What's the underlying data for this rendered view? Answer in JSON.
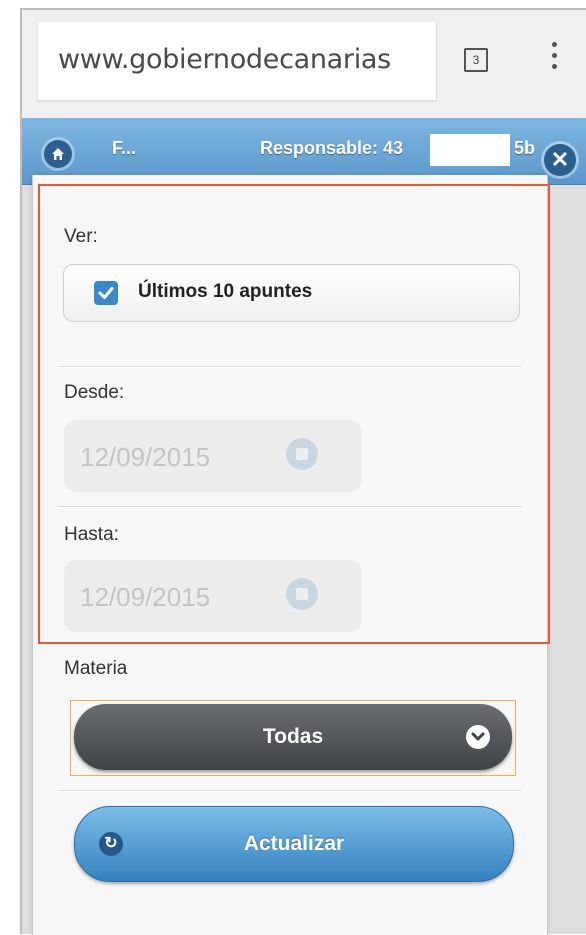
{
  "browser": {
    "url": "www.gobiernodecanarias",
    "tab_count": "3"
  },
  "header": {
    "short_title": "F...",
    "responsable_label": "Responsable: 43",
    "responsable_suffix": "5b",
    "close_symbol": "✕"
  },
  "filters": {
    "ver_label": "Ver:",
    "checkbox_label": "Últimos 10 apuntes",
    "checkbox_checked": true,
    "desde_label": "Desde:",
    "desde_value": "12/09/2015",
    "hasta_label": "Hasta:",
    "hasta_value": "12/09/2015"
  },
  "materia": {
    "label": "Materia",
    "selected": "Todas"
  },
  "actions": {
    "update_label": "Actualizar"
  },
  "colors": {
    "header_blue": "#5a98cc",
    "highlight_border": "#e25a3a",
    "checkbox_blue": "#3a88cc",
    "select_dark": "#4a4e50",
    "update_blue": "#3581bf"
  },
  "icons": [
    "home-icon",
    "close-icon",
    "checkmark-icon",
    "calendar-icon",
    "chevron-down-icon",
    "refresh-icon",
    "menu-dots-icon"
  ]
}
